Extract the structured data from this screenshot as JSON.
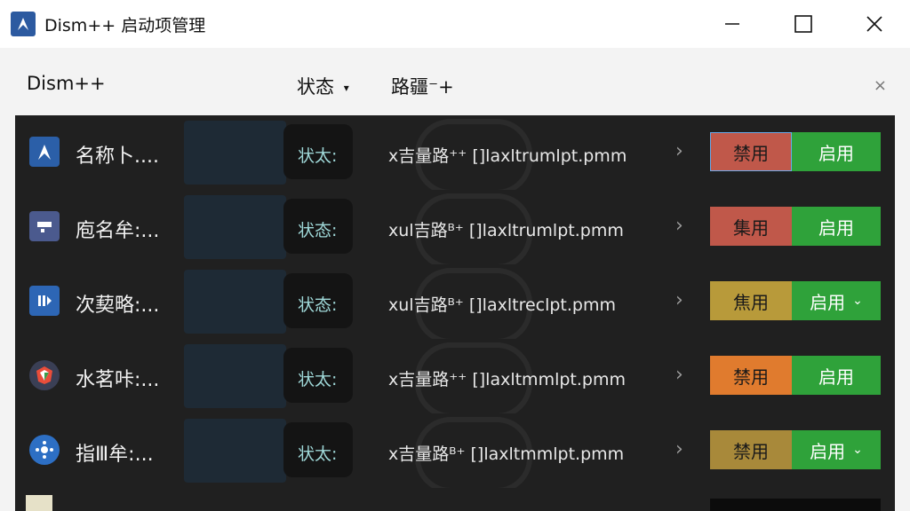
{
  "window": {
    "title": "Dism++ 启动项管理",
    "minimize_glyph": "—",
    "maximize_glyph": "☐",
    "close_glyph": "✕"
  },
  "toolbar": {
    "app_label": "Dism++",
    "status_label": "状态",
    "path_label": "路疆⁻+",
    "close_glyph": "×"
  },
  "rows": [
    {
      "name": "名称卜....",
      "status": "状太:",
      "path": "x吉量路⁺⁺  []laxltrumlpt.pmm",
      "disable": "禁用",
      "enable": "启用",
      "disable_color": "#c0584a",
      "enable_dropdown": false,
      "icon": "arrow-app-icon"
    },
    {
      "name": "庖名牟:...",
      "status": "状态:",
      "path": "xul吉路ᴮ⁺  []laxltrumlpt.pmm",
      "disable": "集用",
      "enable": "启用",
      "disable_color": "#c0584a",
      "enable_dropdown": false,
      "icon": "monitor-app-icon"
    },
    {
      "name": "次葜略:...",
      "status": "状态:",
      "path": "xul吉路ᴮ⁺  []laxltreclpt.pmm",
      "disable": "焦用",
      "enable": "启用",
      "disable_color": "#b89a3a",
      "enable_dropdown": true,
      "icon": "bars-app-icon"
    },
    {
      "name": "水茗咔:...",
      "status": "状太:",
      "path": "x吉量路⁺⁺  []laxltmmlpt.pmm",
      "disable": "禁用",
      "enable": "启用",
      "disable_color": "#e07b2e",
      "enable_dropdown": false,
      "icon": "badge-app-icon"
    },
    {
      "name": "指Ⅲ牟:...",
      "status": "状太:",
      "path": "x吉量路ᴮ⁺  []laxltmmlpt.pmm",
      "disable": "禁用",
      "enable": "启用",
      "disable_color": "#a8893a",
      "enable_dropdown": true,
      "icon": "gear-app-icon"
    }
  ],
  "colors": {
    "enable_green": "#2fa23a",
    "list_bg": "#202020"
  }
}
